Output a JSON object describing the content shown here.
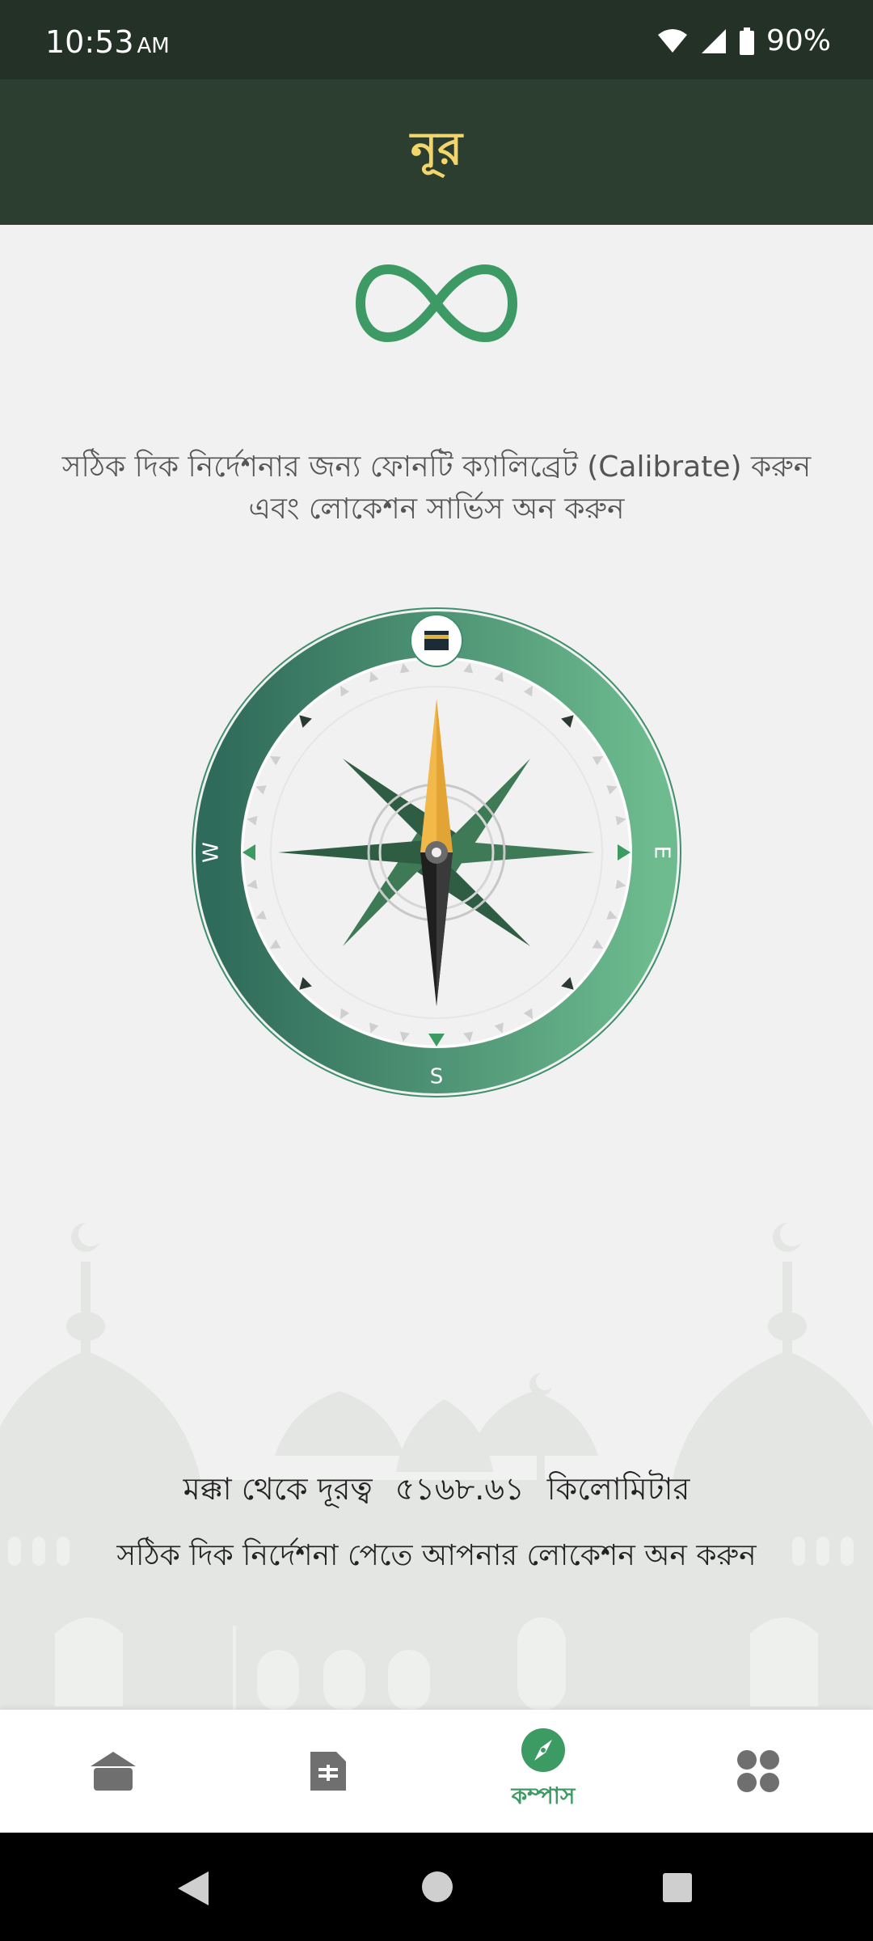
{
  "status_bar": {
    "time": "10:53",
    "ampm": "AM",
    "battery": "90%"
  },
  "app": {
    "title": "নূর"
  },
  "calibration_text": "সঠিক দিক নির্দেশনার জন্য ফোনটি ক্যালিব্রেট (Calibrate) করুন এবং লোকেশন সার্ভিস অন করুন",
  "compass": {
    "west": "W",
    "east": "E",
    "south": "S"
  },
  "distance": {
    "prefix": "মক্কা থেকে দূরত্ব",
    "value": "৫১৬৮.৬১",
    "unit": "কিলোমিটার"
  },
  "location_hint": "সঠিক দিক নির্দেশনা পেতে আপনার লোকেশন অন করুন",
  "bottom_nav": {
    "items": [
      {
        "icon": "home-icon",
        "label": ""
      },
      {
        "icon": "book-icon",
        "label": ""
      },
      {
        "icon": "compass-icon",
        "label": "কম্পাস",
        "active": true
      },
      {
        "icon": "grid-icon",
        "label": ""
      }
    ]
  },
  "colors": {
    "accent": "#3c9a63",
    "appbar": "#2b3e2f",
    "title": "#f2d66b"
  }
}
